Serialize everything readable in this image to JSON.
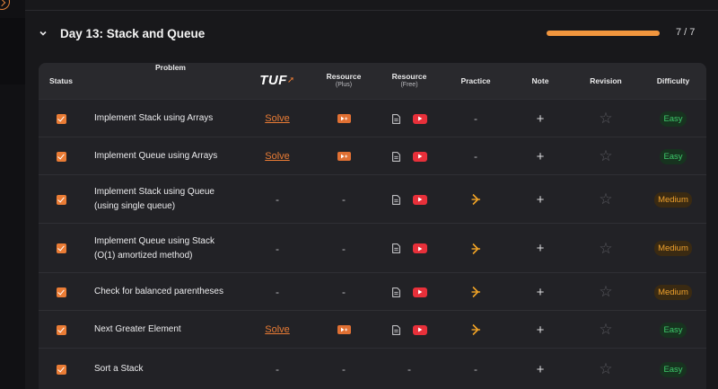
{
  "section": {
    "title": "Day 13: Stack and Queue",
    "progress_text": "7 / 7",
    "progress_fraction": 1.0,
    "accent_color": "#ea7c35"
  },
  "columns": {
    "status": "Status",
    "problem": "Problem",
    "tuf": "TUF",
    "resource_plus": "Resource",
    "resource_plus_sub": "(Plus)",
    "resource_free": "Resource",
    "resource_free_sub": "(Free)",
    "practice": "Practice",
    "note": "Note",
    "revision": "Revision",
    "difficulty": "Difficulty"
  },
  "rows": [
    {
      "problem_line1": "Implement Stack using Arrays",
      "problem_line2": "",
      "tuf": "Solve",
      "plus": "video",
      "free": "doc-yt",
      "practice": "-",
      "difficulty": "Easy",
      "done": true
    },
    {
      "problem_line1": "Implement Queue using Arrays",
      "problem_line2": "",
      "tuf": "Solve",
      "plus": "video",
      "free": "doc-yt",
      "practice": "-",
      "difficulty": "Easy",
      "done": true
    },
    {
      "problem_line1": "Implement Stack using Queue",
      "problem_line2": "(using single queue)",
      "tuf": "-",
      "plus": "-",
      "free": "doc-yt",
      "practice": "link",
      "difficulty": "Medium",
      "done": true
    },
    {
      "problem_line1": "Implement Queue using Stack",
      "problem_line2": "(O(1) amortized method)",
      "tuf": "-",
      "plus": "-",
      "free": "doc-yt",
      "practice": "link",
      "difficulty": "Medium",
      "done": true
    },
    {
      "problem_line1": "Check for balanced parentheses",
      "problem_line2": "",
      "tuf": "-",
      "plus": "-",
      "free": "doc-yt",
      "practice": "link",
      "difficulty": "Medium",
      "done": true
    },
    {
      "problem_line1": "Next Greater Element",
      "problem_line2": "",
      "tuf": "Solve",
      "plus": "video",
      "free": "doc-yt",
      "practice": "link",
      "difficulty": "Easy",
      "done": true
    },
    {
      "problem_line1": "Sort a Stack",
      "problem_line2": "",
      "tuf": "-",
      "plus": "-",
      "free": "-",
      "practice": "-",
      "difficulty": "Easy",
      "done": true
    }
  ],
  "icons": {
    "collapse": "chevron-down-icon",
    "status": "checkbox-checked-icon",
    "plus_resource": "video-play-icon",
    "free_article": "document-icon",
    "free_video": "youtube-icon",
    "practice": "practice-link-icon",
    "note": "plus-icon",
    "revision": "star-outline-icon"
  },
  "labels": {
    "dash": "-",
    "plus": "+",
    "star": "☆"
  }
}
